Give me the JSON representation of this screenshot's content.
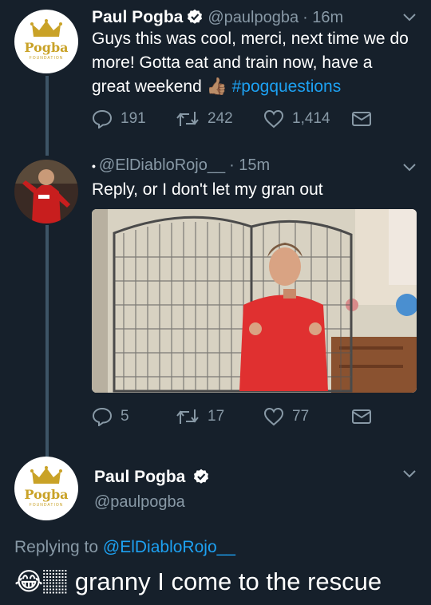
{
  "tweets": [
    {
      "name": "Paul Pogba",
      "handle": "@paulpogba",
      "time": "· 16m",
      "lines": [
        "Guys this was cool, merci, next time we do",
        "more! Gotta eat and train now, have a",
        "great weekend"
      ],
      "emoji": "👍🏽",
      "hashtag": "#pogquestions",
      "replies": "191",
      "retweets": "242",
      "likes": "1,414"
    },
    {
      "name": "",
      "handle": "@ElDiabloRojo__",
      "time": "· 15m",
      "text": "Reply, or I don't let my gran out",
      "replies": "5",
      "retweets": "17",
      "likes": "77"
    }
  ],
  "main": {
    "name": "Paul Pogba",
    "handle": "@paulpogba",
    "replying_prefix": "Replying to",
    "replying_handle": "@ElDiabloRojo__",
    "emoji": "😂🏽",
    "text": "granny I come to the rescue"
  },
  "avatar_logo": {
    "text": "Pogba",
    "sub": "FOUNDATION"
  },
  "icons": {
    "reply": "reply-icon",
    "retweet": "retweet-icon",
    "like": "heart-icon",
    "dm": "envelope-icon",
    "verified": "verified-badge-icon",
    "menu": "chevron-down-icon"
  },
  "colors": {
    "background": "#16202b",
    "link": "#1da1f2",
    "muted": "#8899a6",
    "thread": "#3d5466",
    "gold": "#c9a227"
  }
}
